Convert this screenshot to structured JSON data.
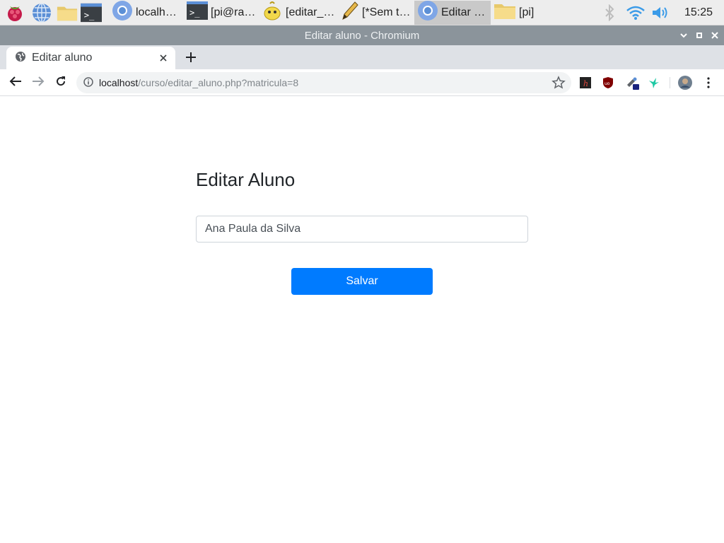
{
  "taskbar": {
    "tasks": [
      {
        "label": "localhost…"
      },
      {
        "label": "[pi@ras…"
      },
      {
        "label": "[editar_b…"
      },
      {
        "label": "[*Sem tít…"
      },
      {
        "label": "Editar al…"
      },
      {
        "label": "[pi]"
      }
    ],
    "clock": "15:25"
  },
  "window": {
    "title": "Editar aluno - Chromium"
  },
  "browser": {
    "tab_title": "Editar aluno",
    "url_host": "localhost",
    "url_path": "/curso/editar_aluno.php?matricula=8"
  },
  "page": {
    "heading": "Editar Aluno",
    "name_value": "Ana Paula da Silva",
    "save_label": "Salvar"
  },
  "colors": {
    "primary_button": "#007bff",
    "titlebar": "#8b949b",
    "tabstrip": "#dee1e6"
  }
}
